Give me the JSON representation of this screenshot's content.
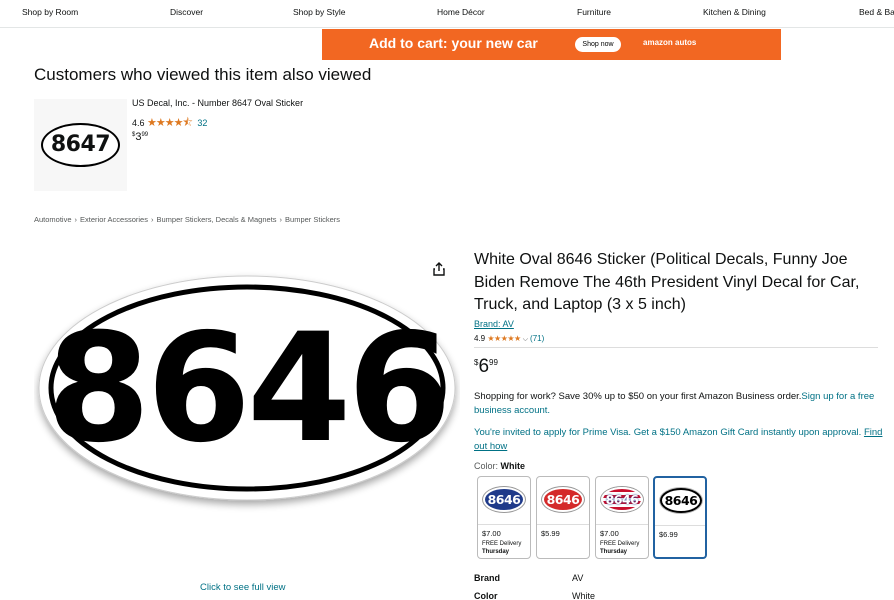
{
  "nav": {
    "items": [
      "Shop by Room",
      "Discover",
      "Shop by Style",
      "Home Décor",
      "Furniture",
      "Kitchen & Dining",
      "Bed & Ba"
    ]
  },
  "ad": {
    "text": "Add to cart: your new car",
    "button": "Shop now",
    "logo": "amazon autos",
    "color": "#f26722"
  },
  "also_viewed": {
    "title": "Customers who viewed this item also viewed",
    "item": {
      "thumb_text": "8647",
      "title": "US Decal, Inc. - Number 8647 Oval Sticker",
      "rating": "4.6",
      "stars": "★★★★⯪",
      "review_count": "32",
      "price_symbol": "$",
      "price_whole": "3",
      "price_fraction": "99"
    }
  },
  "breadcrumb": [
    "Automotive",
    "Exterior Accessories",
    "Bumper Stickers, Decals & Magnets",
    "Bumper Stickers"
  ],
  "breadcrumb_sep": "›",
  "main_image": {
    "number": "8646",
    "full_view": "Click to see full view"
  },
  "product": {
    "title": "White Oval 8646 Sticker (Political Decals, Funny Joe Biden Remove The 46th President Vinyl Decal for Car, Truck, and Laptop (3 x 5 inch)",
    "brand_link": "Brand: AV",
    "rating": "4.9",
    "stars": "★★★★★",
    "rating_count": "(71)",
    "price_symbol": "$",
    "price_whole": "6",
    "price_fraction": "99",
    "business": {
      "text": "Shopping for work? Save 30% up to $50 on your first Amazon Business order.",
      "link": "Sign up for a free business account."
    },
    "visa": {
      "text": "You're invited to apply for Prime Visa. Get a $150 Amazon Gift Card instantly upon approval.",
      "link": "Find out how"
    },
    "color_label": "Color:",
    "color_value": "White",
    "swatches": [
      {
        "label": "8646",
        "price": "$7.00",
        "delivery": "FREE Delivery",
        "day": "Thursday",
        "bg": "#1f3a8a",
        "fg": "#ffffff"
      },
      {
        "label": "8646",
        "price": "$5.99",
        "delivery": "",
        "day": "",
        "bg": "#d42a2a",
        "fg": "#ffffff"
      },
      {
        "label": "8646",
        "price": "$7.00",
        "delivery": "FREE Delivery",
        "day": "Thursday",
        "bg": "#b03a3a",
        "fg": "#ffffff"
      },
      {
        "label": "8646",
        "price": "$6.99",
        "delivery": "",
        "day": "",
        "bg": "#ffffff",
        "fg": "#000000"
      }
    ],
    "specs": [
      {
        "key": "Brand",
        "value": "AV"
      },
      {
        "key": "Color",
        "value": "White"
      }
    ]
  }
}
